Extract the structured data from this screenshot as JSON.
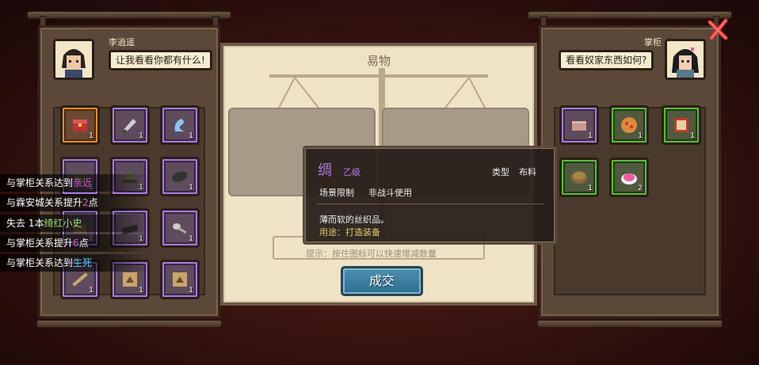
{
  "left_panel": {
    "character_name": "李逍遥",
    "speech": "让我看看你都有什么!",
    "slots": [
      {
        "rarity": "orange",
        "icon": "treasure-chest-icon",
        "qty": "1"
      },
      {
        "rarity": "purple",
        "icon": "cleaver-icon",
        "qty": "1"
      },
      {
        "rarity": "purple",
        "icon": "blue-ribbon-icon",
        "qty": "1"
      },
      {
        "rarity": "purple",
        "icon": "herb-bundle-icon",
        "qty": "1"
      },
      {
        "rarity": "purple",
        "icon": "hat-icon",
        "qty": "1"
      },
      {
        "rarity": "purple",
        "icon": "dark-leaf-icon",
        "qty": "1"
      },
      {
        "rarity": "purple",
        "icon": "cloth-icon",
        "qty": "1"
      },
      {
        "rarity": "purple",
        "icon": "black-bolt-icon",
        "qty": "1"
      },
      {
        "rarity": "purple",
        "icon": "spoon-icon",
        "qty": "1"
      },
      {
        "rarity": "purple",
        "icon": "flute-icon",
        "qty": "1"
      },
      {
        "rarity": "purple",
        "icon": "scroll-map-icon",
        "qty": "1"
      },
      {
        "rarity": "purple",
        "icon": "scroll-map-icon",
        "qty": "1"
      }
    ]
  },
  "right_panel": {
    "character_name": "掌柜",
    "speech": "看看奴家东西如何?",
    "slots": [
      {
        "rarity": "purple",
        "icon": "fabric-roll-icon",
        "qty": "1"
      },
      {
        "rarity": "green",
        "icon": "pizza-dish-icon",
        "qty": "1"
      },
      {
        "rarity": "green",
        "icon": "book-icon",
        "qty": "1"
      },
      {
        "rarity": "green",
        "icon": "basket-icon",
        "qty": "1"
      },
      {
        "rarity": "green",
        "icon": "pink-cake-icon",
        "qty": "2"
      }
    ]
  },
  "center": {
    "title": "易物",
    "hint": "提示：按住图标可以快速增减数量",
    "deal_label": "成交"
  },
  "tooltip": {
    "name": "绸",
    "grade": "乙级",
    "type_label": "类型",
    "type_value": "布料",
    "scene_label": "场景限制",
    "scene_value": "非战斗使用",
    "description": "薄而软的丝织品。",
    "usage": "用途：打造装备"
  },
  "notifications": [
    {
      "prefix": "与掌柜关系达到",
      "highlight": "亲近",
      "suffix": ""
    },
    {
      "prefix": "与霖安城关系提升",
      "highlight": "2",
      "suffix": "点"
    },
    {
      "prefix": "失去 1本",
      "highlight": "绮红小史",
      "suffix": ""
    },
    {
      "prefix": "与掌柜关系提升",
      "highlight": "6",
      "suffix": "点"
    },
    {
      "prefix": "与掌柜关系达到",
      "highlight": "生死",
      "suffix": ""
    }
  ],
  "colors": {
    "rarity_purple": "#a77be0",
    "rarity_orange": "#e08a2b",
    "rarity_green": "#5dbb3a",
    "tooltip_name": "#b57ae8",
    "deal_button": "#3a80a0"
  }
}
